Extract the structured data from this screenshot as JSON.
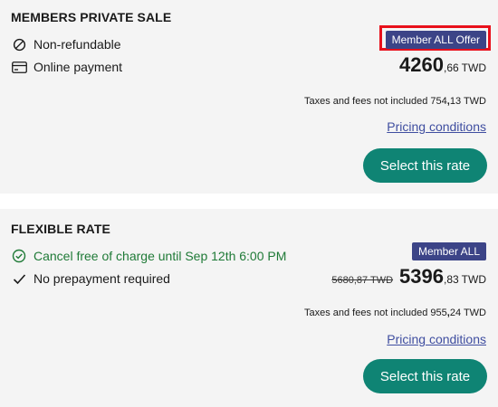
{
  "rates": [
    {
      "title": "MEMBERS PRIVATE SALE",
      "features": [
        {
          "icon": "no-refund-icon",
          "text": "Non-refundable"
        },
        {
          "icon": "credit-card-icon",
          "text": "Online payment"
        }
      ],
      "badge": "Member ALL Offer",
      "badge_highlight_color": "#e8101b",
      "price_main": "4260",
      "price_cents": ",66",
      "currency": "TWD",
      "taxes_label": "Taxes and fees not included",
      "taxes_int": "754",
      "taxes_sep": ",",
      "taxes_dec": "13",
      "taxes_currency": "TWD",
      "pricing_link": "Pricing conditions",
      "select_label": "Select this rate"
    },
    {
      "title": "FLEXIBLE RATE",
      "features": [
        {
          "icon": "check-circle-icon",
          "text": "Cancel free of charge until Sep 12th 6:00 PM",
          "color": "#1f7a37"
        },
        {
          "icon": "check-icon",
          "text": "No prepayment required"
        }
      ],
      "badge": "Member ALL",
      "old_price": "5680,87 TWD",
      "price_main": "5396",
      "price_cents": ",83",
      "currency": "TWD",
      "taxes_label": "Taxes and fees not included",
      "taxes_int": "955",
      "taxes_sep": ",",
      "taxes_dec": "24",
      "taxes_currency": "TWD",
      "pricing_link": "Pricing conditions",
      "select_label": "Select this rate"
    }
  ],
  "colors": {
    "card_bg": "#f4f4f4",
    "badge_bg": "#3c4487",
    "button_bg": "#0f8474",
    "link": "#3f4ea0",
    "green_text": "#1f7a37"
  }
}
